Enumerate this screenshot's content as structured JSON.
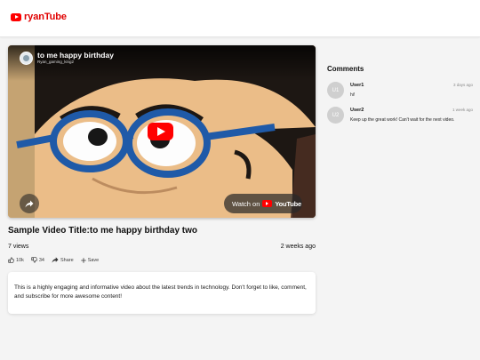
{
  "header": {
    "logo_text": "ryanTube",
    "logo_icon": "play-logo-icon",
    "brand_color": "#ff0000"
  },
  "player": {
    "title": "to me happy birthday",
    "channel": "Ryan_gaming_king2",
    "watch_on": "Watch on",
    "watch_brand": "YouTube",
    "play_icon": "play-icon",
    "share_icon": "share-arrow-icon"
  },
  "video": {
    "title": "Sample Video Title:to me happy birthday two",
    "views": "7 views",
    "uploaded": "2 weeks ago",
    "actions": {
      "like": "10k",
      "dislike": "34",
      "share": "Share",
      "save": "Save"
    },
    "description": "This is a highly engaging and informative video about the latest trends in technology. Don't forget to like, comment, and subscribe for more awesome content!"
  },
  "comments": {
    "title": "Comments",
    "items": [
      {
        "avatar": "U1",
        "user": "User1",
        "time": "3 days ago",
        "text": "hi!"
      },
      {
        "avatar": "U2",
        "user": "User2",
        "time": "1 week ago",
        "text": "Keep up the great work! Can't wait for the next video."
      }
    ]
  }
}
